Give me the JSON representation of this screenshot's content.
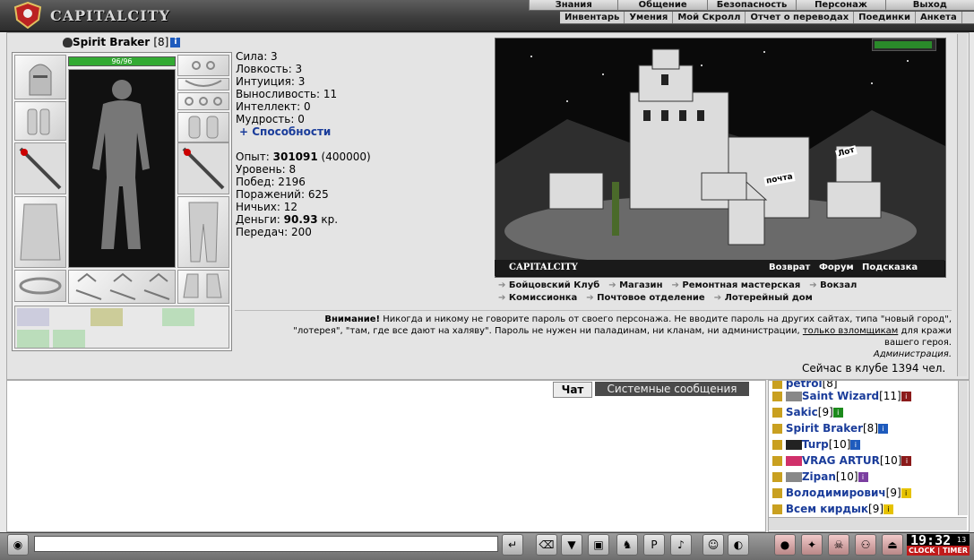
{
  "header": {
    "logo": "CAPITALCITY",
    "menu_top": [
      "Знания",
      "Общение",
      "Безопасность",
      "Персонаж",
      "Выход"
    ],
    "menu_sub": [
      "Инвентарь",
      "Умения",
      "Мой Скролл",
      "Отчет о переводах",
      "Поединки",
      "Анкета"
    ]
  },
  "character": {
    "name": "Spirit Braker",
    "level": "[8]",
    "hp": "96/96"
  },
  "stats": {
    "strength": "Сила: 3",
    "agility": "Ловкость: 3",
    "intuition": "Интуиция: 3",
    "endurance": "Выносливость: 11",
    "intellect": "Интеллект: 0",
    "wisdom": "Мудрость: 0",
    "abilities": "+ Способности",
    "exp_label": "Опыт: ",
    "exp_value": "301091",
    "exp_next": " (400000)",
    "level": "Уровень: 8",
    "wins": "Побед: 2196",
    "losses": "Поражений: 625",
    "draws": "Ничьих: 12",
    "money_label": "Деньги: ",
    "money_value": "90.93",
    "money_unit": " кр.",
    "transfers": "Передач: 200"
  },
  "city": {
    "name": "CAPITALCITY",
    "back": "Возврат",
    "forum": "Форум",
    "hint": "Подсказка",
    "sign_post": "почта",
    "sign_shop": "Лот"
  },
  "locations": [
    "Бойцовский Клуб",
    "Магазин",
    "Ремонтная мастерская",
    "Вокзал",
    "Комиссионка",
    "Почтовое отделение",
    "Лотерейный дом"
  ],
  "warning": {
    "title": "Внимание!",
    "text1": " Никогда и никому не говорите пароль от своего персонажа. Не вводите пароль на других сайтах, типа \"новый город\",",
    "text2": "\"лотерея\", \"там, где все дают на халяву\". Пароль не нужен ни паладинам, ни кланам, ни администрации, ",
    "link": "только взломщикам",
    "text3": " для кражи",
    "text4": "вашего героя.",
    "sign": "Администрация."
  },
  "online": "Сейчас в клубе 1394 чел.",
  "chat": {
    "tab_chat": "Чат",
    "tab_system": "Системные сообщения"
  },
  "users": [
    {
      "name": "petrol",
      "level": "[8]"
    },
    {
      "name": "Saint Wizard",
      "level": "[11]"
    },
    {
      "name": "Sakic",
      "level": "[9]"
    },
    {
      "name": "Spirit Braker",
      "level": "[8]"
    },
    {
      "name": "Turp",
      "level": "[10]"
    },
    {
      "name": "VRAG ARTUR",
      "level": "[10]"
    },
    {
      "name": "Zipan",
      "level": "[10]"
    },
    {
      "name": "Володимирович",
      "level": "[9]"
    },
    {
      "name": "Всем кирдык",
      "level": "[9]"
    }
  ],
  "clock": {
    "time": "19:32",
    "seconds": "13",
    "label": "CLOCK | TIMER"
  },
  "colors": {
    "accent": "#1a3c9a",
    "hp": "#33aa33",
    "alert": "#c01a1a"
  }
}
